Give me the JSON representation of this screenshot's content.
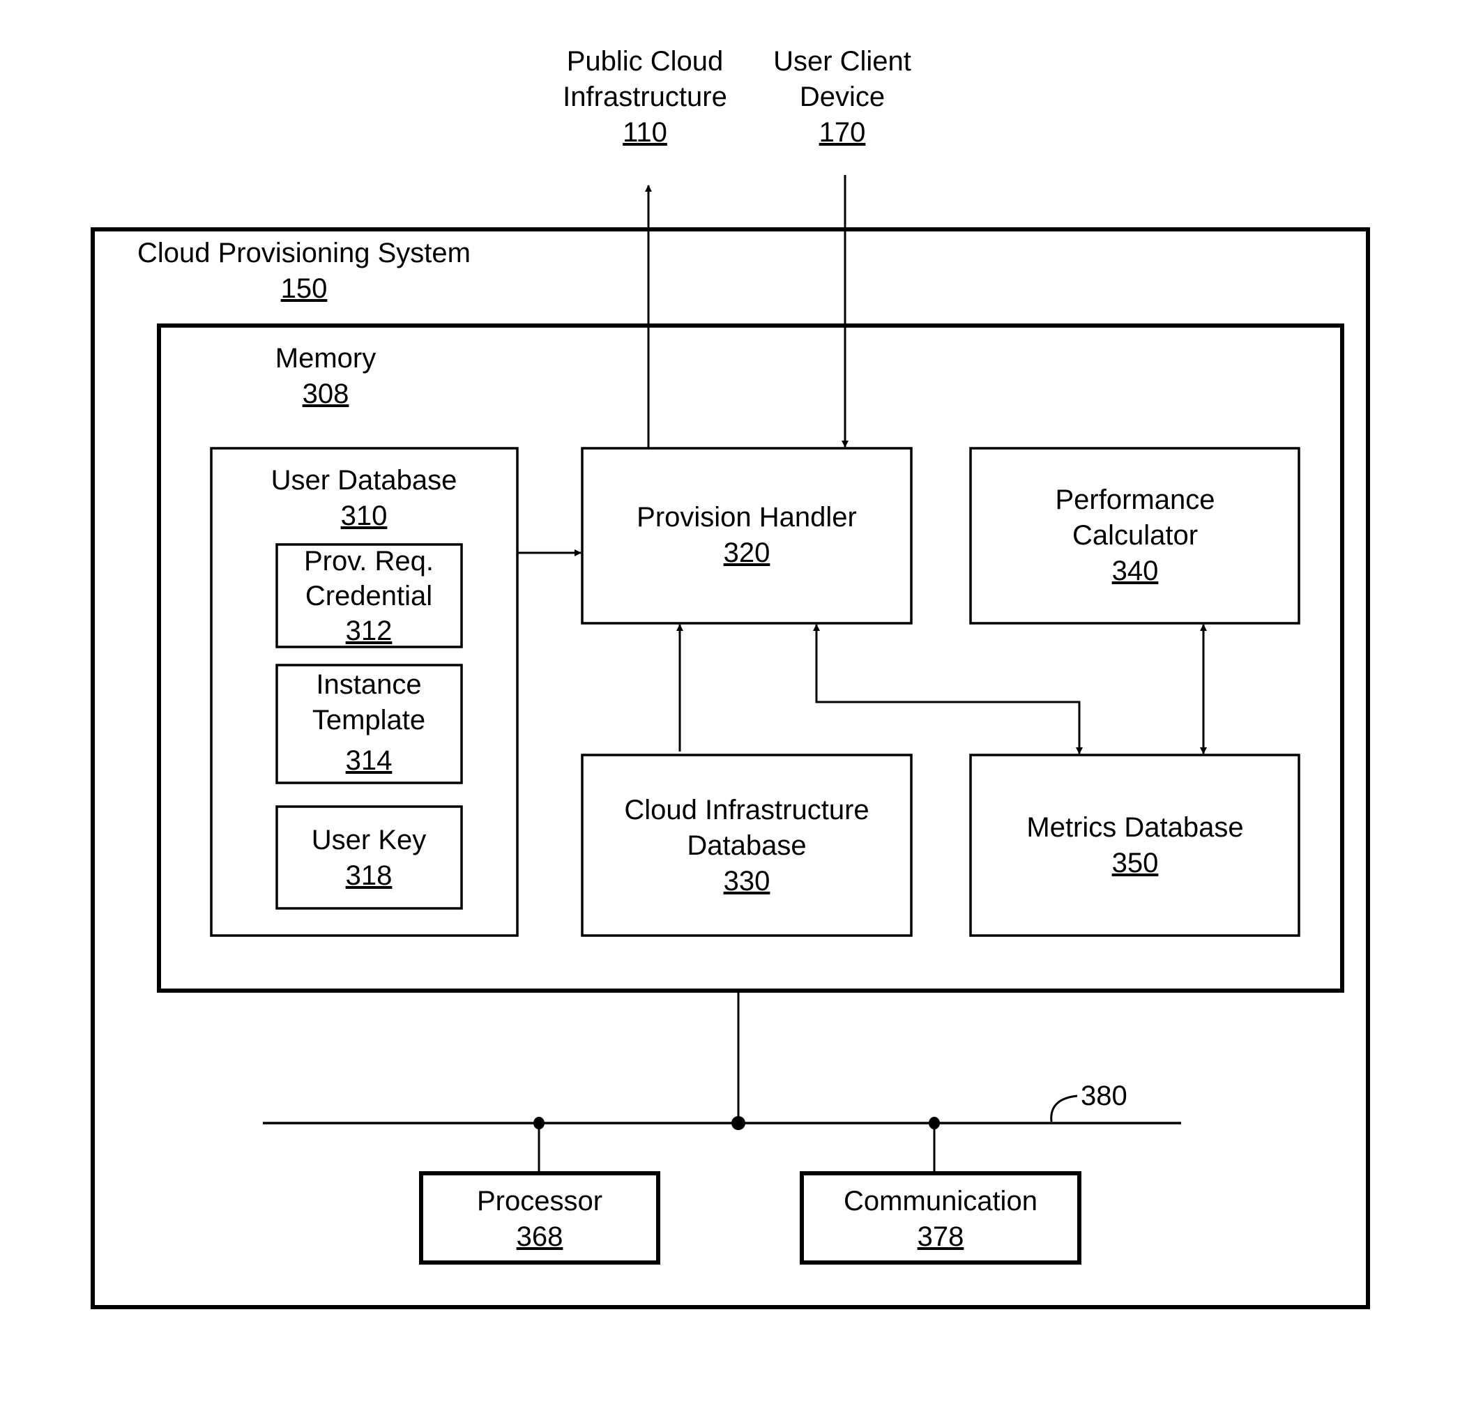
{
  "external": {
    "public_cloud": {
      "line1": "Public Cloud",
      "line2": "Infrastructure",
      "ref": "110"
    },
    "user_client": {
      "line1": "User Client",
      "line2": "Device",
      "ref": "170"
    }
  },
  "system": {
    "label": "Cloud Provisioning System",
    "ref": "150"
  },
  "memory": {
    "label": "Memory",
    "ref": "308"
  },
  "user_database": {
    "label": "User Database",
    "ref": "310",
    "children": {
      "prov_req": {
        "line1": "Prov. Req.",
        "line2": "Credential",
        "ref": "312"
      },
      "instance_template": {
        "line1": "Instance",
        "line2": "Template",
        "ref": "314"
      },
      "user_key": {
        "line1": "User Key",
        "ref": "318"
      }
    }
  },
  "provision_handler": {
    "label": "Provision Handler",
    "ref": "320"
  },
  "performance_calculator": {
    "line1": "Performance",
    "line2": "Calculator",
    "ref": "340"
  },
  "cloud_infra_db": {
    "line1": "Cloud Infrastructure",
    "line2": "Database",
    "ref": "330"
  },
  "metrics_db": {
    "label": "Metrics Database",
    "ref": "350"
  },
  "bus": {
    "ref": "380"
  },
  "processor": {
    "label": "Processor",
    "ref": "368"
  },
  "communication": {
    "label": "Communication",
    "ref": "378"
  }
}
